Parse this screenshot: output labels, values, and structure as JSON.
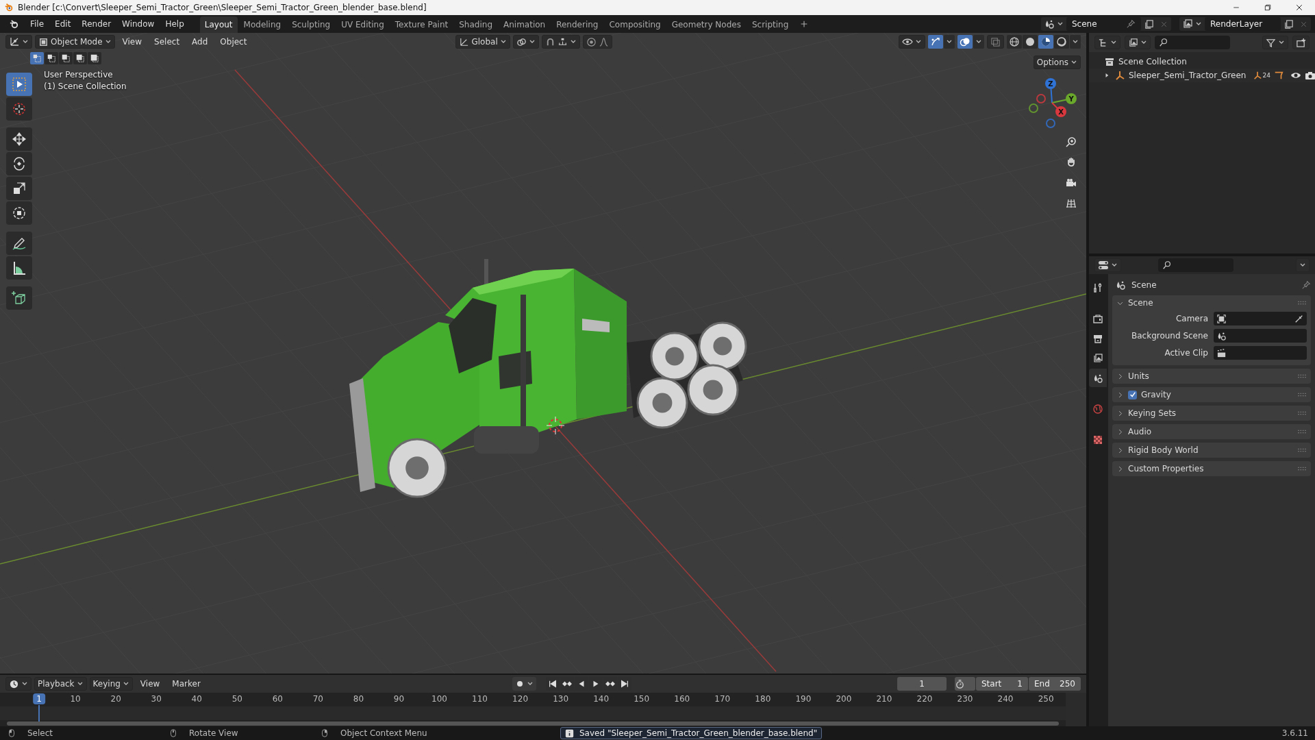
{
  "title_bar": {
    "title": "Blender [c:\\Convert\\Sleeper_Semi_Tractor_Green\\Sleeper_Semi_Tractor_Green_blender_base.blend]"
  },
  "menu": [
    "File",
    "Edit",
    "Render",
    "Window",
    "Help"
  ],
  "workspaces": [
    {
      "label": "Layout",
      "selected": true
    },
    {
      "label": "Modeling",
      "selected": false
    },
    {
      "label": "Sculpting",
      "selected": false
    },
    {
      "label": "UV Editing",
      "selected": false
    },
    {
      "label": "Texture Paint",
      "selected": false
    },
    {
      "label": "Shading",
      "selected": false
    },
    {
      "label": "Animation",
      "selected": false
    },
    {
      "label": "Rendering",
      "selected": false
    },
    {
      "label": "Compositing",
      "selected": false
    },
    {
      "label": "Geometry Nodes",
      "selected": false
    },
    {
      "label": "Scripting",
      "selected": false
    }
  ],
  "scene": {
    "value": "Scene"
  },
  "view_layer": {
    "value": "RenderLayer"
  },
  "viewport": {
    "mode": "Object Mode",
    "menus": [
      "View",
      "Select",
      "Add",
      "Object"
    ],
    "orientation": "Global",
    "select_modes": [
      {
        "selected": true
      },
      {
        "selected": false
      },
      {
        "selected": false
      },
      {
        "selected": false
      },
      {
        "selected": false
      }
    ],
    "snap": false,
    "proportional_editing": false,
    "gizmos": true,
    "overlays": true,
    "shading": [
      {
        "kind": "wireframe",
        "selected": false
      },
      {
        "kind": "solid",
        "selected": false
      },
      {
        "kind": "material",
        "selected": true
      },
      {
        "kind": "rendered",
        "selected": false
      }
    ],
    "options": "Options",
    "info": [
      "User Perspective",
      "(1) Scene Collection"
    ],
    "tools": [
      {
        "kind": "select",
        "selected": true
      },
      {
        "kind": "cursor",
        "selected": false
      },
      {
        "kind": "move",
        "selected": false
      },
      {
        "kind": "rotate",
        "selected": false
      },
      {
        "kind": "scale",
        "selected": false
      },
      {
        "kind": "transform",
        "selected": false
      },
      {
        "kind": "annotate",
        "selected": false
      },
      {
        "kind": "measure",
        "selected": false
      },
      {
        "kind": "add_cube",
        "selected": false
      }
    ],
    "gizmo_axes": [
      "Z",
      "Y",
      "X"
    ]
  },
  "outliner": {
    "items": [
      {
        "label": "Scene Collection",
        "children": [
          {
            "label": "Sleeper_Semi_Tractor_Green",
            "expanded": false,
            "badge": "24"
          }
        ]
      }
    ]
  },
  "properties": {
    "tabs": [
      {
        "kind": "tool",
        "selected": false
      },
      {
        "kind": "render",
        "selected": false
      },
      {
        "kind": "output",
        "selected": false
      },
      {
        "kind": "view_layer",
        "selected": false
      },
      {
        "kind": "scene",
        "selected": true
      },
      {
        "kind": "world",
        "selected": false
      },
      {
        "kind": "texture",
        "selected": false
      }
    ],
    "context": "Scene",
    "panels": [
      {
        "title": "Scene",
        "expanded": true,
        "fields": [
          {
            "label": "Camera",
            "kind": "camera"
          },
          {
            "label": "Background Scene",
            "kind": "scene"
          },
          {
            "label": "Active Clip",
            "kind": "clip"
          }
        ]
      },
      {
        "title": "Units",
        "expanded": false
      },
      {
        "title": "Gravity",
        "expanded": false,
        "kind": "checkbox",
        "checked": true
      },
      {
        "title": "Keying Sets",
        "expanded": false
      },
      {
        "title": "Audio",
        "expanded": false
      },
      {
        "title": "Rigid Body World",
        "expanded": false
      },
      {
        "title": "Custom Properties",
        "expanded": false
      }
    ]
  },
  "timeline": {
    "menus": [
      {
        "label": "Playback",
        "kind": "dropdown"
      },
      {
        "label": "Keying",
        "kind": "dropdown"
      },
      {
        "label": "View",
        "kind": "menu"
      },
      {
        "label": "Marker",
        "kind": "menu"
      }
    ],
    "auto_keying": false,
    "preview_range": false,
    "current_frame": "1",
    "start": {
      "label": "Start",
      "value": "1"
    },
    "end": {
      "label": "End",
      "value": "250"
    },
    "ruler": {
      "current": "1",
      "ticks": [
        "10",
        "20",
        "30",
        "40",
        "50",
        "60",
        "70",
        "80",
        "90",
        "100",
        "110",
        "120",
        "130",
        "140",
        "150",
        "160",
        "170",
        "180",
        "190",
        "200",
        "210",
        "220",
        "230",
        "240",
        "250"
      ]
    }
  },
  "status_bar": {
    "hints": [
      "Select",
      "Rotate View",
      "Object Context Menu"
    ],
    "message": "Saved \"Sleeper_Semi_Tractor_Green_blender_base.blend\"",
    "version": "3.6.11"
  }
}
